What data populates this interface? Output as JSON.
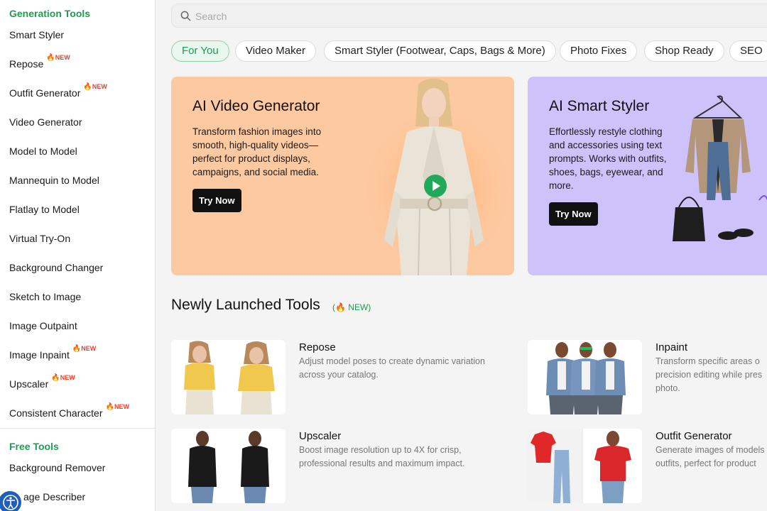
{
  "sidebar": {
    "gen_title": "Generation Tools",
    "items": [
      {
        "label": "Smart Styler",
        "badge": ""
      },
      {
        "label": "Repose",
        "badge": "NEW"
      },
      {
        "label": "Outfit Generator",
        "badge": "NEW"
      },
      {
        "label": "Video Generator",
        "badge": ""
      },
      {
        "label": "Model to Model",
        "badge": ""
      },
      {
        "label": "Mannequin to Model",
        "badge": ""
      },
      {
        "label": "Flatlay to Model",
        "badge": ""
      },
      {
        "label": "Virtual Try-On",
        "badge": ""
      },
      {
        "label": "Background Changer",
        "badge": ""
      },
      {
        "label": "Sketch to Image",
        "badge": ""
      },
      {
        "label": "Image Outpaint",
        "badge": ""
      },
      {
        "label": "Image Inpaint",
        "badge": "NEW"
      },
      {
        "label": "Upscaler",
        "badge": "NEW"
      },
      {
        "label": "Consistent Character",
        "badge": "NEW"
      }
    ],
    "free_title": "Free Tools",
    "free_items": [
      {
        "label": "Background Remover"
      },
      {
        "label": "age Describer"
      }
    ]
  },
  "search": {
    "placeholder": "Search"
  },
  "chips": [
    "For You",
    "Video Maker",
    "Smart Styler (Footwear, Caps, Bags & More)",
    "Photo Fixes",
    "Shop Ready",
    "SEO"
  ],
  "banners": [
    {
      "title": "AI Video Generator",
      "desc": [
        "Transform fashion images into",
        "smooth, high-quality videos—",
        "perfect for product displays,",
        "campaigns, and social media."
      ],
      "cta": "Try Now"
    },
    {
      "title": "AI Smart Styler",
      "desc": [
        "Effortlessly restyle clothing",
        "and accessories using text",
        "prompts. Works with outfits,",
        "shoes, bags, eyewear, and",
        "more."
      ],
      "cta": "Try Now"
    }
  ],
  "newly": {
    "title": "Newly Launched Tools",
    "badge": "NEW)",
    "badge_open": "("
  },
  "tools": [
    {
      "name": "Repose",
      "desc": [
        "Adjust model poses to create dynamic variation",
        "across your catalog."
      ]
    },
    {
      "name": "Inpaint",
      "desc": [
        "Transform specific areas o",
        "precision editing while pres",
        "photo."
      ]
    },
    {
      "name": "Upscaler",
      "desc": [
        "Boost image resolution up to 4X for crisp,",
        "professional results and maximum impact."
      ]
    },
    {
      "name": "Outfit Generator",
      "desc": [
        "Generate images of models",
        "outfits, perfect for product"
      ]
    }
  ],
  "colors": {
    "brand_green": "#1a9e52",
    "new_red": "#e8412b",
    "orange_banner": "#fdc9a0",
    "purple_banner": "#cec2fb"
  }
}
